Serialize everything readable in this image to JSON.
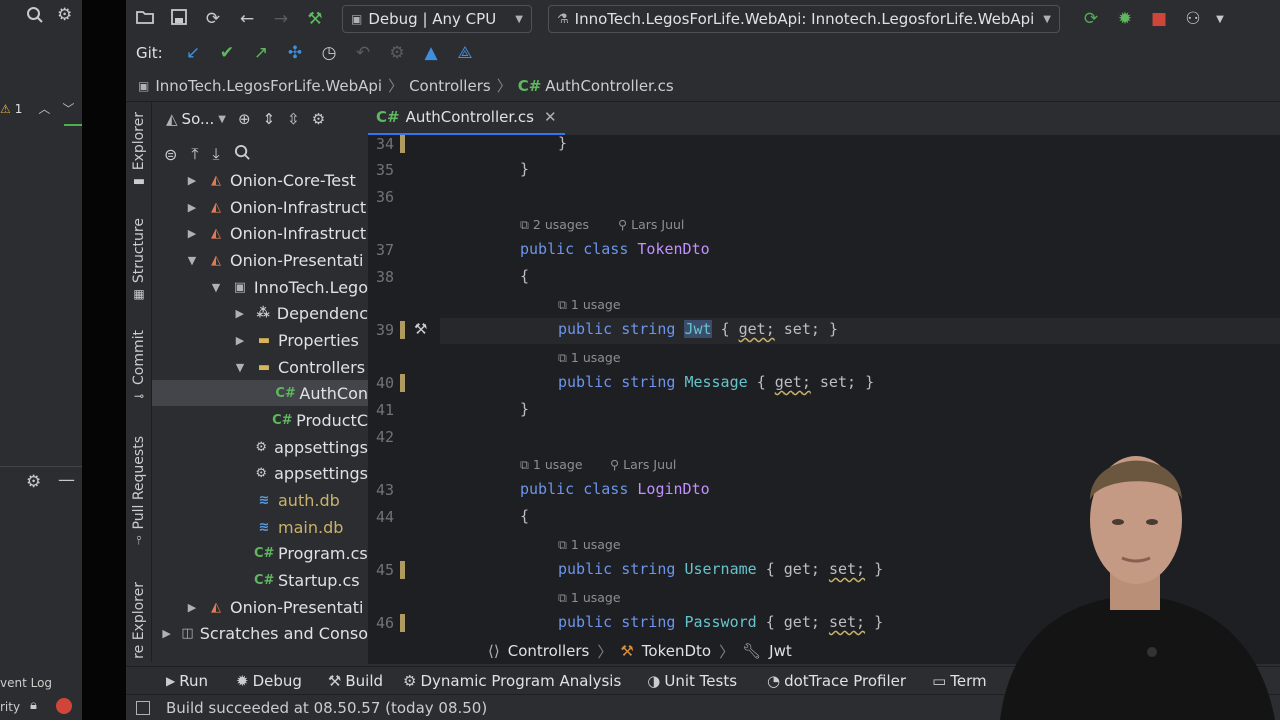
{
  "left_window": {
    "warning_count": "1",
    "event_log_label": "vent Log",
    "bottom_label": "rity"
  },
  "toolbar": {
    "run_config": "Debug | Any CPU",
    "project_config": "InnoTech.LegosForLife.WebApi: Innotech.LegosforLife.WebApi",
    "git_label": "Git:"
  },
  "breadcrumb_top": {
    "project": "InnoTech.LegosForLife.WebApi",
    "folder": "Controllers",
    "file_lang": "C#",
    "file": "AuthController.cs"
  },
  "tool_stripe": {
    "explorer": "Explorer",
    "structure": "Structure",
    "commit": "Commit",
    "pull_requests": "Pull Requests",
    "explorer2": "re Explorer"
  },
  "explorer": {
    "title": "So...",
    "items": [
      {
        "label": "Onion-Core-Test",
        "type": "project"
      },
      {
        "label": "Onion-Infrastruct",
        "type": "project"
      },
      {
        "label": "Onion-Infrastruct",
        "type": "project"
      },
      {
        "label": "Onion-Presentati",
        "type": "project"
      },
      {
        "label": "InnoTech.Lego",
        "type": "csproj"
      },
      {
        "label": "Dependenc",
        "type": "deps"
      },
      {
        "label": "Properties",
        "type": "folder"
      },
      {
        "label": "Controllers",
        "type": "folder"
      },
      {
        "label": "AuthCon",
        "type": "cs"
      },
      {
        "label": "ProductC",
        "type": "cs"
      },
      {
        "label": "appsettings",
        "type": "json"
      },
      {
        "label": "appsettings",
        "type": "json"
      },
      {
        "label": "auth.db",
        "type": "db"
      },
      {
        "label": "main.db",
        "type": "db"
      },
      {
        "label": "Program.cs",
        "type": "cs"
      },
      {
        "label": "Startup.cs",
        "type": "cs"
      },
      {
        "label": "Onion-Presentati",
        "type": "project"
      },
      {
        "label": "Scratches and Conso",
        "type": "scratch"
      }
    ]
  },
  "editor": {
    "tab_lang": "C#",
    "tab_label": "AuthController.cs",
    "line_numbers": [
      "34",
      "35",
      "36",
      "37",
      "38",
      "39",
      "40",
      "41",
      "42",
      "43",
      "44",
      "45",
      "46"
    ],
    "hints": {
      "tokendto_usages": "2 usages",
      "tokendto_author": "Lars Juul",
      "jwt_usage": "1 usage",
      "message_usage": "1 usage",
      "logindto_usages": "1 usage",
      "logindto_author": "Lars Juul",
      "username_usage": "1 usage",
      "password_usage": "1 usage"
    },
    "code": {
      "public": "public",
      "class": "class",
      "string": "string",
      "tokendto": "TokenDto",
      "logindto": "LoginDto",
      "jwt": "Jwt",
      "message": "Message",
      "username": "Username",
      "password": "Password",
      "get": "get;",
      "set": "set;",
      "open_brace": "{",
      "close_brace": "}"
    }
  },
  "editor_crumbs": {
    "folder": "Controllers",
    "class": "TokenDto",
    "member": "Jwt"
  },
  "bottom_tools": {
    "run": "Run",
    "debug": "Debug",
    "build": "Build",
    "dpa": "Dynamic Program Analysis",
    "unit_tests": "Unit Tests",
    "dottrace": "dotTrace Profiler",
    "terminal": "Term"
  },
  "status": {
    "message": "Build succeeded at 08.50.57  (today 08.50)"
  },
  "colors": {
    "keyword": "#6c95eb",
    "type": "#c191ff",
    "property": "#66c3cc",
    "accent": "#3574f0"
  }
}
